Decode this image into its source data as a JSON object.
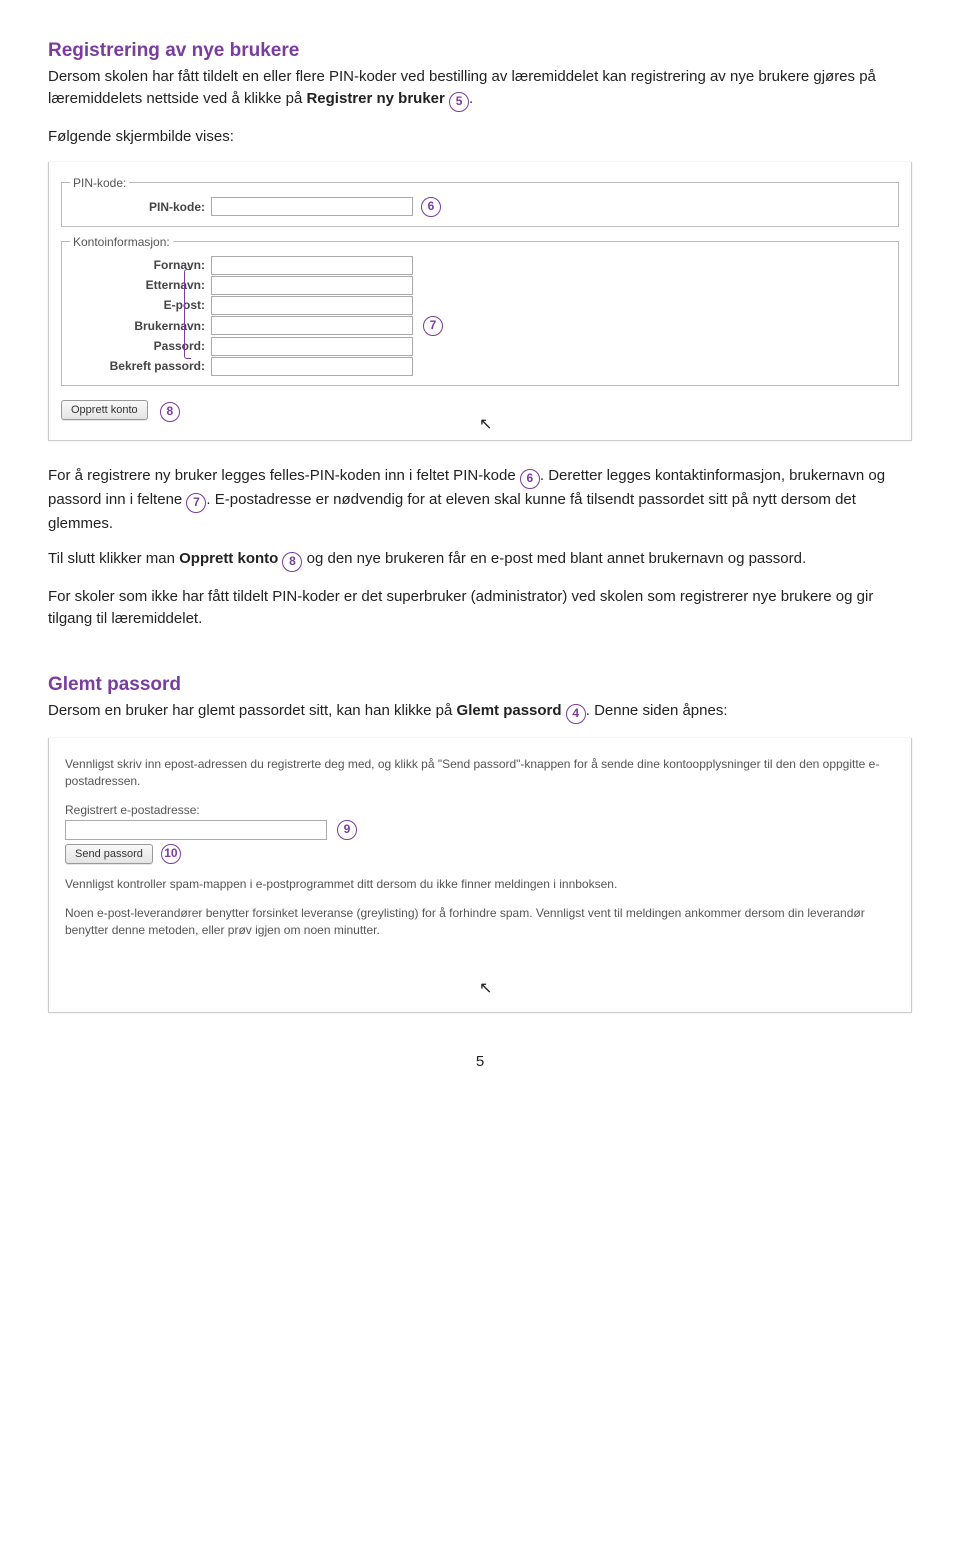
{
  "section1": {
    "title": "Registrering av nye brukere",
    "para1a": "Dersom skolen har fått tildelt en eller flere PIN-koder ved bestilling av læremiddelet kan registrering av nye brukere gjøres på læremiddelets nettside ved å klikke på ",
    "para1bold": "Registrer ny bruker",
    "para1c": " ",
    "ref5": "5",
    "para1d": ".",
    "para2": "Følgende skjermbilde vises:"
  },
  "panel1": {
    "legend_pin": "PIN-kode:",
    "label_pin": "PIN-kode:",
    "ref6": "6",
    "legend_konto": "Kontoinformasjon:",
    "label_fornavn": "Fornavn:",
    "label_etternavn": "Etternavn:",
    "label_epost": "E-post:",
    "label_brukernavn": "Brukernavn:",
    "label_passord": "Passord:",
    "label_bekreft": "Bekreft passord:",
    "ref7": "7",
    "btn_opprett": "Opprett konto",
    "ref8": "8"
  },
  "section2": {
    "p1a": "For å registrere ny bruker legges felles-PIN-koden inn i feltet PIN-kode ",
    "r6": "6",
    "p1b": ". Deretter legges kontaktinformasjon, brukernavn og passord inn i feltene ",
    "r7": "7",
    "p1c": ". E-postadresse er nødvendig for at eleven skal kunne få tilsendt passordet sitt på nytt dersom det glemmes.",
    "p2a": "Til slutt klikker man ",
    "p2bold": "Opprett konto",
    "p2b": " ",
    "r8": "8",
    "p2c": " og den nye brukeren får en e-post med blant annet brukernavn og passord.",
    "p3": "For skoler som ikke har fått tildelt PIN-koder er det superbruker (administrator) ved skolen som registrerer nye brukere og gir tilgang til læremiddelet."
  },
  "section3": {
    "title": "Glemt passord",
    "p1a": "Dersom en bruker har glemt passordet sitt, kan han klikke på ",
    "p1bold": "Glemt passord",
    "p1b": " ",
    "r4": "4",
    "p1c": ". Denne siden åpnes:"
  },
  "panel2": {
    "p1": "Vennligst skriv inn epost-adressen du registrerte deg med, og klikk på \"Send passord\"-knappen for å sende dine kontoopplysninger til den den oppgitte e-postadressen.",
    "label_email": "Registrert e-postadresse:",
    "r9": "9",
    "btn_send": "Send passord",
    "r10": "10",
    "p2": "Vennligst kontroller spam-mappen i e-postprogrammet ditt dersom du ikke finner meldingen i innboksen.",
    "p3": "Noen e-post-leverandører benytter forsinket leveranse (greylisting) for å forhindre spam. Vennligst vent til meldingen ankommer dersom din leverandør benytter denne metoden, eller prøv igjen om noen minutter."
  },
  "page_number": "5"
}
